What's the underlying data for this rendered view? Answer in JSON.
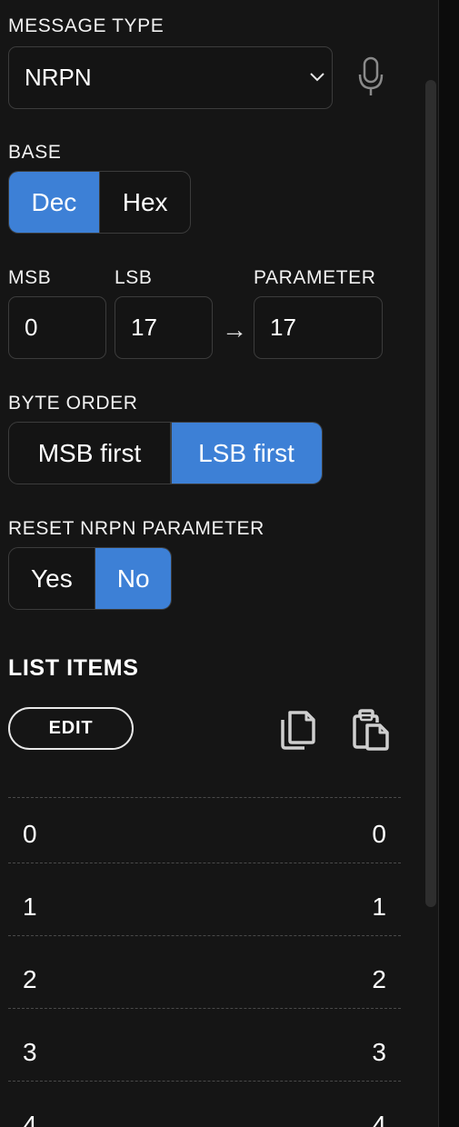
{
  "message_type": {
    "label": "MESSAGE TYPE",
    "value": "NRPN"
  },
  "base": {
    "label": "BASE",
    "options": [
      "Dec",
      "Hex"
    ],
    "selected": "Dec"
  },
  "msb": {
    "label": "MSB",
    "value": "0"
  },
  "lsb": {
    "label": "LSB",
    "value": "17"
  },
  "parameter": {
    "label": "PARAMETER",
    "value": "17"
  },
  "byte_order": {
    "label": "BYTE ORDER",
    "options": [
      "MSB first",
      "LSB first"
    ],
    "selected": "LSB first"
  },
  "reset_nrpn": {
    "label": "RESET NRPN PARAMETER",
    "options": [
      "Yes",
      "No"
    ],
    "selected": "No"
  },
  "list": {
    "heading": "LIST ITEMS",
    "edit_label": "EDIT",
    "items": [
      {
        "key": "0",
        "value": "0"
      },
      {
        "key": "1",
        "value": "1"
      },
      {
        "key": "2",
        "value": "2"
      },
      {
        "key": "3",
        "value": "3"
      },
      {
        "key": "4",
        "value": "4"
      }
    ]
  },
  "icons": {
    "mic": "microphone-icon",
    "copy": "copy-icon",
    "paste": "paste-icon",
    "arrow": "arrow-right-icon",
    "dropdown": "chevron-down-icon"
  },
  "colors": {
    "accent": "#3d80d6",
    "background": "#151515",
    "border": "#3c3c3c"
  }
}
